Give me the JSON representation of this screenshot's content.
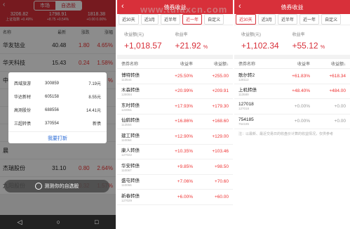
{
  "watermark": "www.tulaxcn.com",
  "p1": {
    "back": "‹",
    "tabs": [
      "市场",
      "自选股"
    ],
    "indices": [
      {
        "value": "3206.82",
        "change": "上证指数 +0.49%"
      },
      {
        "value": "1798.91",
        "change": "+8.75  +0.54%"
      },
      {
        "value": "1818.38",
        "change": "+0.00  0.00%"
      }
    ],
    "columns": [
      "名称",
      "最新",
      "涨跌",
      "涨幅"
    ],
    "rows": [
      {
        "name": "华友钴业",
        "code": "",
        "price": "40.48",
        "chg": "1.80",
        "pct": "4.65%",
        "down": false
      },
      {
        "name": "华天科技",
        "code": "",
        "price": "15.43",
        "chg": "0.24",
        "pct": "1.58%",
        "down": false
      },
      {
        "name": "中",
        "code": "",
        "price": "",
        "chg": "",
        "pct": "%",
        "down": false
      },
      {
        "name": "",
        "code": "",
        "price": "",
        "chg": "",
        "pct": "",
        "down": false
      },
      {
        "name": "",
        "code": "",
        "price": "",
        "chg": "",
        "pct": "",
        "down": false
      },
      {
        "name": "",
        "code": "",
        "price": "",
        "chg": "",
        "pct": "",
        "down": false
      },
      {
        "name": "晨",
        "code": "",
        "price": "",
        "chg": "",
        "pct": "",
        "down": false
      },
      {
        "name": "杰瑞股份",
        "code": "",
        "price": "31.10",
        "chg": "0.80",
        "pct": "2.64%",
        "down": false
      },
      {
        "name": "九阳股份",
        "code": "",
        "price": "20.66",
        "chg": "0.32",
        "pct": "1.57%",
        "down": false
      }
    ],
    "dialog": {
      "rows": [
        {
          "name": "西域旅游",
          "code": "300859",
          "price": "7.19元"
        },
        {
          "name": "华达新材",
          "code": "605158",
          "price": "8.55元"
        },
        {
          "name": "高测股份",
          "code": "688556",
          "price": "14.41元"
        },
        {
          "name": "三超转债",
          "code": "370554",
          "price": "新债"
        }
      ],
      "button": "我要打新"
    },
    "pill": "测测你的自选股",
    "nav": [
      "◁",
      "○",
      "□"
    ]
  },
  "p2": {
    "title": "债券收益",
    "back": "‹",
    "tabs": [
      "近30天",
      "近3月",
      "近半年",
      "近一年",
      "自定义"
    ],
    "active_tab": 3,
    "summary": {
      "amount_label": "收益额(元)",
      "amount": "+1,018.57",
      "rate_label": "收益率",
      "rate": "+21.92",
      "rate_unit": "%"
    },
    "columns": [
      "债券名称",
      "收益率",
      "收益额↓"
    ],
    "rows": [
      {
        "name": "博特转债",
        "code": "113544",
        "rate": "+25.50%",
        "amount": "+255.00"
      },
      {
        "name": "木森转债",
        "code": "128084",
        "rate": "+20.99%",
        "amount": "+209.91"
      },
      {
        "name": "东时转债",
        "code": "123051",
        "rate": "+17.93%",
        "amount": "+179.30"
      },
      {
        "name": "仙鹤转债",
        "code": "113554",
        "rate": "+16.86%",
        "amount": "+168.60"
      },
      {
        "name": "建工转债",
        "code": "110064",
        "rate": "+12.90%",
        "amount": "+129.00"
      },
      {
        "name": "康人转债",
        "code": "127022",
        "rate": "+10.35%",
        "amount": "+103.46"
      },
      {
        "name": "华安转债",
        "code": "110067",
        "rate": "+9.85%",
        "amount": "+98.50"
      },
      {
        "name": "盛屯转债",
        "code": "110066",
        "rate": "+7.06%",
        "amount": "+70.60"
      },
      {
        "name": "新春转债",
        "code": "127029",
        "rate": "+6.00%",
        "amount": "+60.00"
      }
    ]
  },
  "p3": {
    "title": "债券收益",
    "back": "‹",
    "tabs": [
      "近30天",
      "近3月",
      "近半年",
      "近一年",
      "自定义"
    ],
    "active_tab": 0,
    "summary": {
      "amount_label": "收益额(元)",
      "amount": "+1,102.34",
      "rate_label": "收益率",
      "rate": "+55.12",
      "rate_unit": "%"
    },
    "columns": [
      "债券名称",
      "收益率",
      "收益额↓"
    ],
    "rows": [
      {
        "name": "歌尔转2",
        "code": "128112",
        "rate": "+61.83%",
        "amount": "+618.34",
        "zero": false
      },
      {
        "name": "上机转债",
        "code": "113589",
        "rate": "+48.40%",
        "amount": "+484.00",
        "zero": false
      },
      {
        "name": "127018",
        "code": "127018",
        "rate": "+0.00%",
        "amount": "+0.00",
        "zero": true
      },
      {
        "name": "754185",
        "code": "754185",
        "rate": "+0.00%",
        "amount": "+0.00",
        "zero": true
      }
    ],
    "note": "注：以最新、最近交易日的收盘价计算的收益情况，仅供参考"
  }
}
